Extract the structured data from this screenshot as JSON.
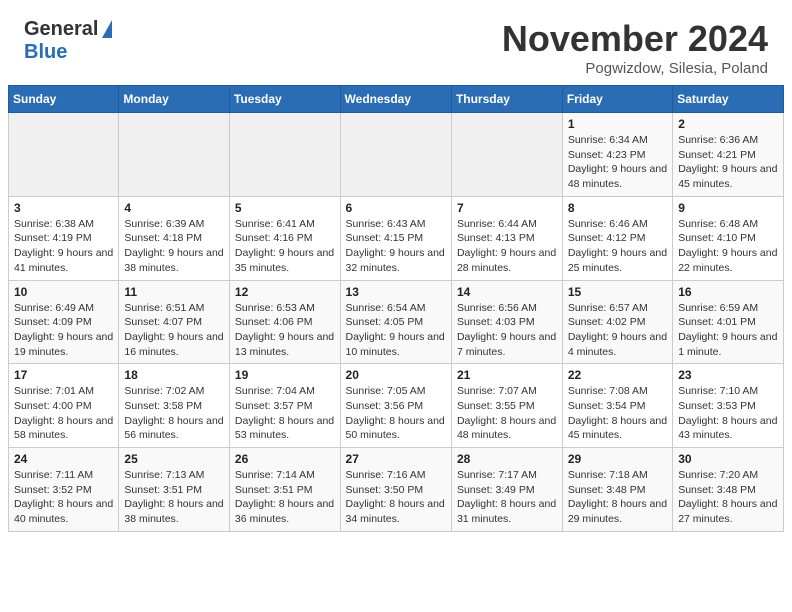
{
  "header": {
    "logo_general": "General",
    "logo_blue": "Blue",
    "month_title": "November 2024",
    "location": "Pogwizdow, Silesia, Poland"
  },
  "days_of_week": [
    "Sunday",
    "Monday",
    "Tuesday",
    "Wednesday",
    "Thursday",
    "Friday",
    "Saturday"
  ],
  "weeks": [
    [
      {
        "day": "",
        "info": ""
      },
      {
        "day": "",
        "info": ""
      },
      {
        "day": "",
        "info": ""
      },
      {
        "day": "",
        "info": ""
      },
      {
        "day": "",
        "info": ""
      },
      {
        "day": "1",
        "info": "Sunrise: 6:34 AM\nSunset: 4:23 PM\nDaylight: 9 hours and 48 minutes."
      },
      {
        "day": "2",
        "info": "Sunrise: 6:36 AM\nSunset: 4:21 PM\nDaylight: 9 hours and 45 minutes."
      }
    ],
    [
      {
        "day": "3",
        "info": "Sunrise: 6:38 AM\nSunset: 4:19 PM\nDaylight: 9 hours and 41 minutes."
      },
      {
        "day": "4",
        "info": "Sunrise: 6:39 AM\nSunset: 4:18 PM\nDaylight: 9 hours and 38 minutes."
      },
      {
        "day": "5",
        "info": "Sunrise: 6:41 AM\nSunset: 4:16 PM\nDaylight: 9 hours and 35 minutes."
      },
      {
        "day": "6",
        "info": "Sunrise: 6:43 AM\nSunset: 4:15 PM\nDaylight: 9 hours and 32 minutes."
      },
      {
        "day": "7",
        "info": "Sunrise: 6:44 AM\nSunset: 4:13 PM\nDaylight: 9 hours and 28 minutes."
      },
      {
        "day": "8",
        "info": "Sunrise: 6:46 AM\nSunset: 4:12 PM\nDaylight: 9 hours and 25 minutes."
      },
      {
        "day": "9",
        "info": "Sunrise: 6:48 AM\nSunset: 4:10 PM\nDaylight: 9 hours and 22 minutes."
      }
    ],
    [
      {
        "day": "10",
        "info": "Sunrise: 6:49 AM\nSunset: 4:09 PM\nDaylight: 9 hours and 19 minutes."
      },
      {
        "day": "11",
        "info": "Sunrise: 6:51 AM\nSunset: 4:07 PM\nDaylight: 9 hours and 16 minutes."
      },
      {
        "day": "12",
        "info": "Sunrise: 6:53 AM\nSunset: 4:06 PM\nDaylight: 9 hours and 13 minutes."
      },
      {
        "day": "13",
        "info": "Sunrise: 6:54 AM\nSunset: 4:05 PM\nDaylight: 9 hours and 10 minutes."
      },
      {
        "day": "14",
        "info": "Sunrise: 6:56 AM\nSunset: 4:03 PM\nDaylight: 9 hours and 7 minutes."
      },
      {
        "day": "15",
        "info": "Sunrise: 6:57 AM\nSunset: 4:02 PM\nDaylight: 9 hours and 4 minutes."
      },
      {
        "day": "16",
        "info": "Sunrise: 6:59 AM\nSunset: 4:01 PM\nDaylight: 9 hours and 1 minute."
      }
    ],
    [
      {
        "day": "17",
        "info": "Sunrise: 7:01 AM\nSunset: 4:00 PM\nDaylight: 8 hours and 58 minutes."
      },
      {
        "day": "18",
        "info": "Sunrise: 7:02 AM\nSunset: 3:58 PM\nDaylight: 8 hours and 56 minutes."
      },
      {
        "day": "19",
        "info": "Sunrise: 7:04 AM\nSunset: 3:57 PM\nDaylight: 8 hours and 53 minutes."
      },
      {
        "day": "20",
        "info": "Sunrise: 7:05 AM\nSunset: 3:56 PM\nDaylight: 8 hours and 50 minutes."
      },
      {
        "day": "21",
        "info": "Sunrise: 7:07 AM\nSunset: 3:55 PM\nDaylight: 8 hours and 48 minutes."
      },
      {
        "day": "22",
        "info": "Sunrise: 7:08 AM\nSunset: 3:54 PM\nDaylight: 8 hours and 45 minutes."
      },
      {
        "day": "23",
        "info": "Sunrise: 7:10 AM\nSunset: 3:53 PM\nDaylight: 8 hours and 43 minutes."
      }
    ],
    [
      {
        "day": "24",
        "info": "Sunrise: 7:11 AM\nSunset: 3:52 PM\nDaylight: 8 hours and 40 minutes."
      },
      {
        "day": "25",
        "info": "Sunrise: 7:13 AM\nSunset: 3:51 PM\nDaylight: 8 hours and 38 minutes."
      },
      {
        "day": "26",
        "info": "Sunrise: 7:14 AM\nSunset: 3:51 PM\nDaylight: 8 hours and 36 minutes."
      },
      {
        "day": "27",
        "info": "Sunrise: 7:16 AM\nSunset: 3:50 PM\nDaylight: 8 hours and 34 minutes."
      },
      {
        "day": "28",
        "info": "Sunrise: 7:17 AM\nSunset: 3:49 PM\nDaylight: 8 hours and 31 minutes."
      },
      {
        "day": "29",
        "info": "Sunrise: 7:18 AM\nSunset: 3:48 PM\nDaylight: 8 hours and 29 minutes."
      },
      {
        "day": "30",
        "info": "Sunrise: 7:20 AM\nSunset: 3:48 PM\nDaylight: 8 hours and 27 minutes."
      }
    ]
  ]
}
